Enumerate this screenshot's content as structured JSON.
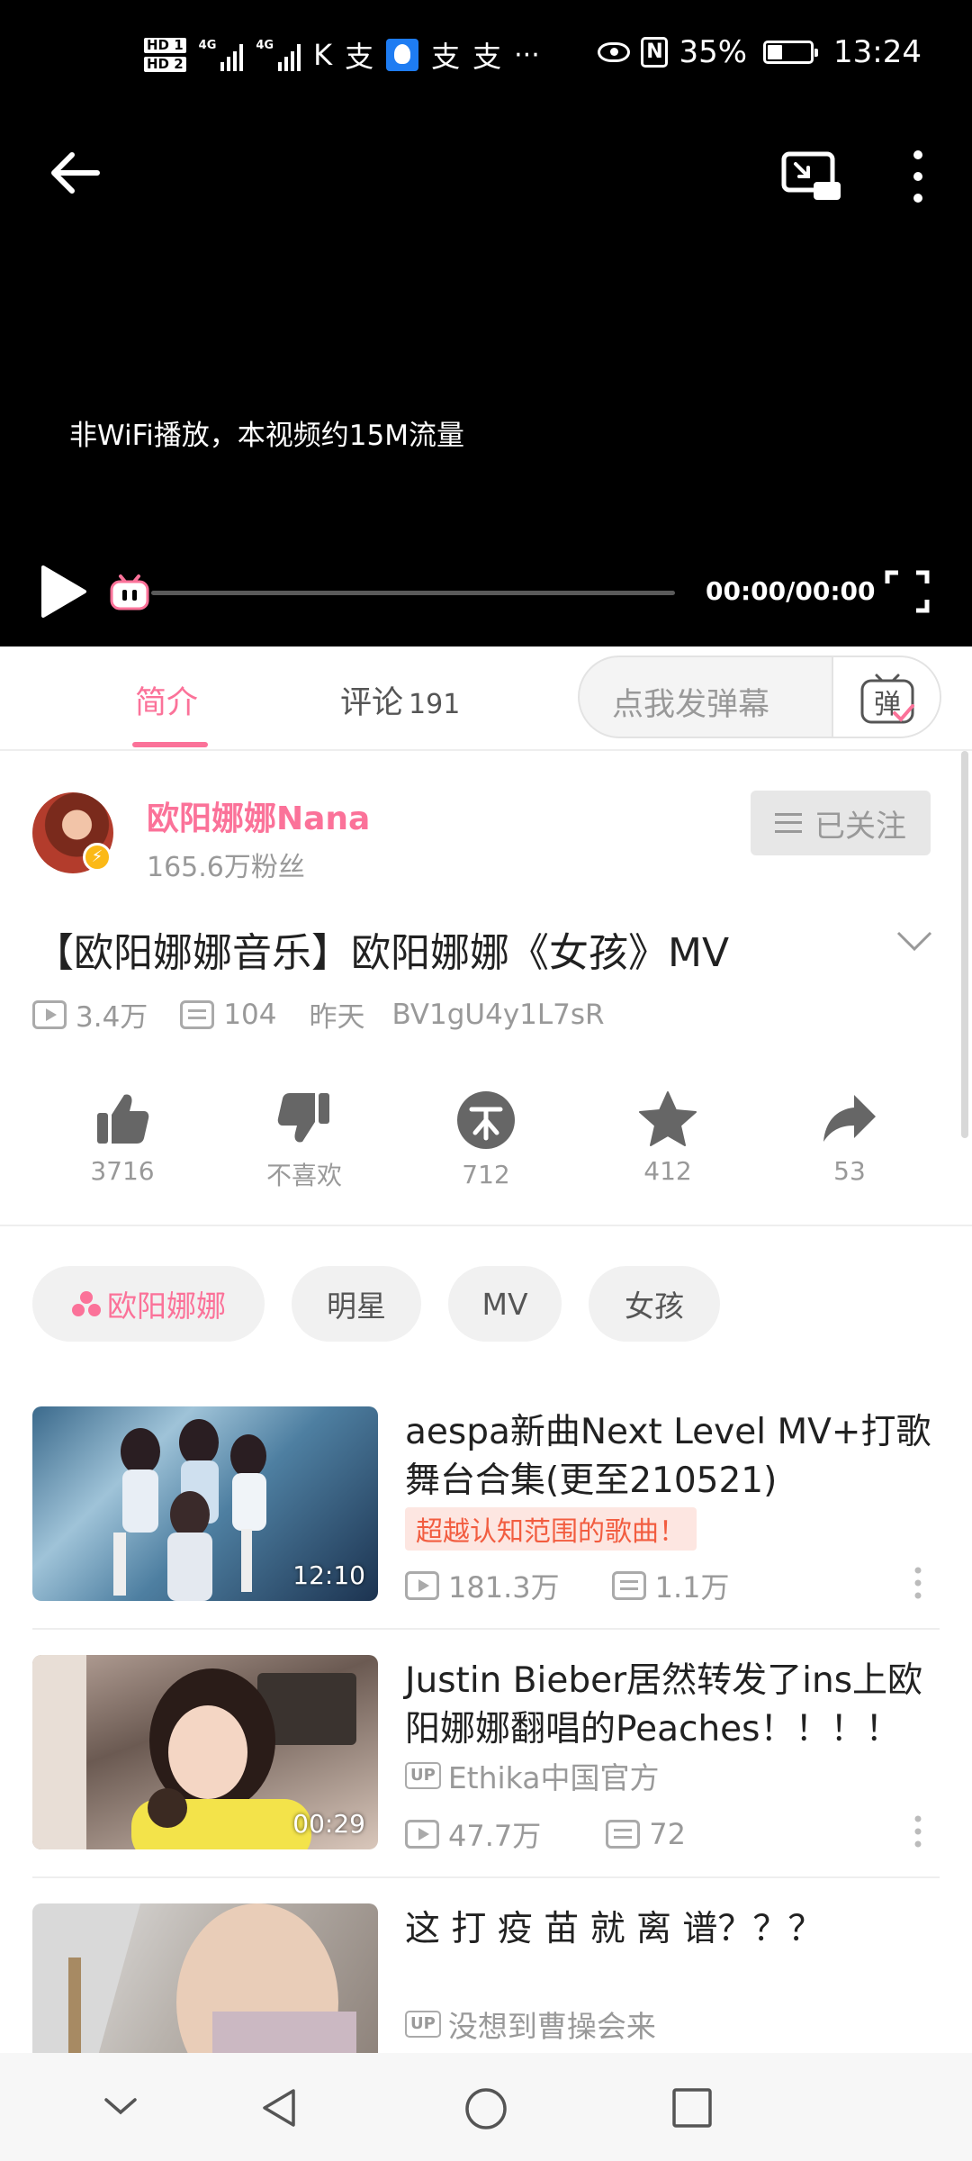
{
  "status_bar": {
    "hd1": "HD 1",
    "hd2": "HD 2",
    "net1": "4G",
    "net2": "4G",
    "app_icons": [
      "K",
      "支",
      "qq-icon",
      "支",
      "支"
    ],
    "overflow": "···",
    "battery": "35%",
    "time": "13:24"
  },
  "player": {
    "notice": "非WiFi播放，本视频约15M流量",
    "time": "00:00/00:00",
    "progress": 0
  },
  "tabs": {
    "intro": "简介",
    "comments": "评论",
    "comments_count": "191",
    "danmaku_placeholder": "点我发弹幕",
    "danmaku_icon_char": "弹"
  },
  "uploader": {
    "name": "欧阳娜娜Nana",
    "fans": "165.6万粉丝",
    "follow_label": "已关注"
  },
  "video": {
    "title": "【欧阳娜娜音乐】欧阳娜娜《女孩》MV",
    "views": "3.4万",
    "danmaku": "104",
    "date": "昨天",
    "bvid": "BV1gU4y1L7sR"
  },
  "actions": {
    "like": "3716",
    "dislike": "不喜欢",
    "coin": "712",
    "favorite": "412",
    "share": "53"
  },
  "tags": [
    "欧阳娜娜",
    "明星",
    "MV",
    "女孩"
  ],
  "recommendations": [
    {
      "title": "aespa新曲Next Level MV+打歌舞台合集(更至210521)",
      "badge": "超越认知范围的歌曲！",
      "duration": "12:10",
      "views": "181.3万",
      "danmaku": "1.1万"
    },
    {
      "title": "Justin Bieber居然转发了ins上欧阳娜娜翻唱的Peaches！！！！",
      "up_label": "UP",
      "uploader": "Ethika中国官方",
      "duration": "00:29",
      "views": "47.7万",
      "danmaku": "72"
    },
    {
      "title": "这 打 疫 苗 就 离 谱？？？",
      "up_label": "UP",
      "uploader": "没想到曹操会来"
    }
  ],
  "colors": {
    "accent": "#fb7299",
    "badge_text": "#f25d40",
    "muted": "#999999"
  }
}
